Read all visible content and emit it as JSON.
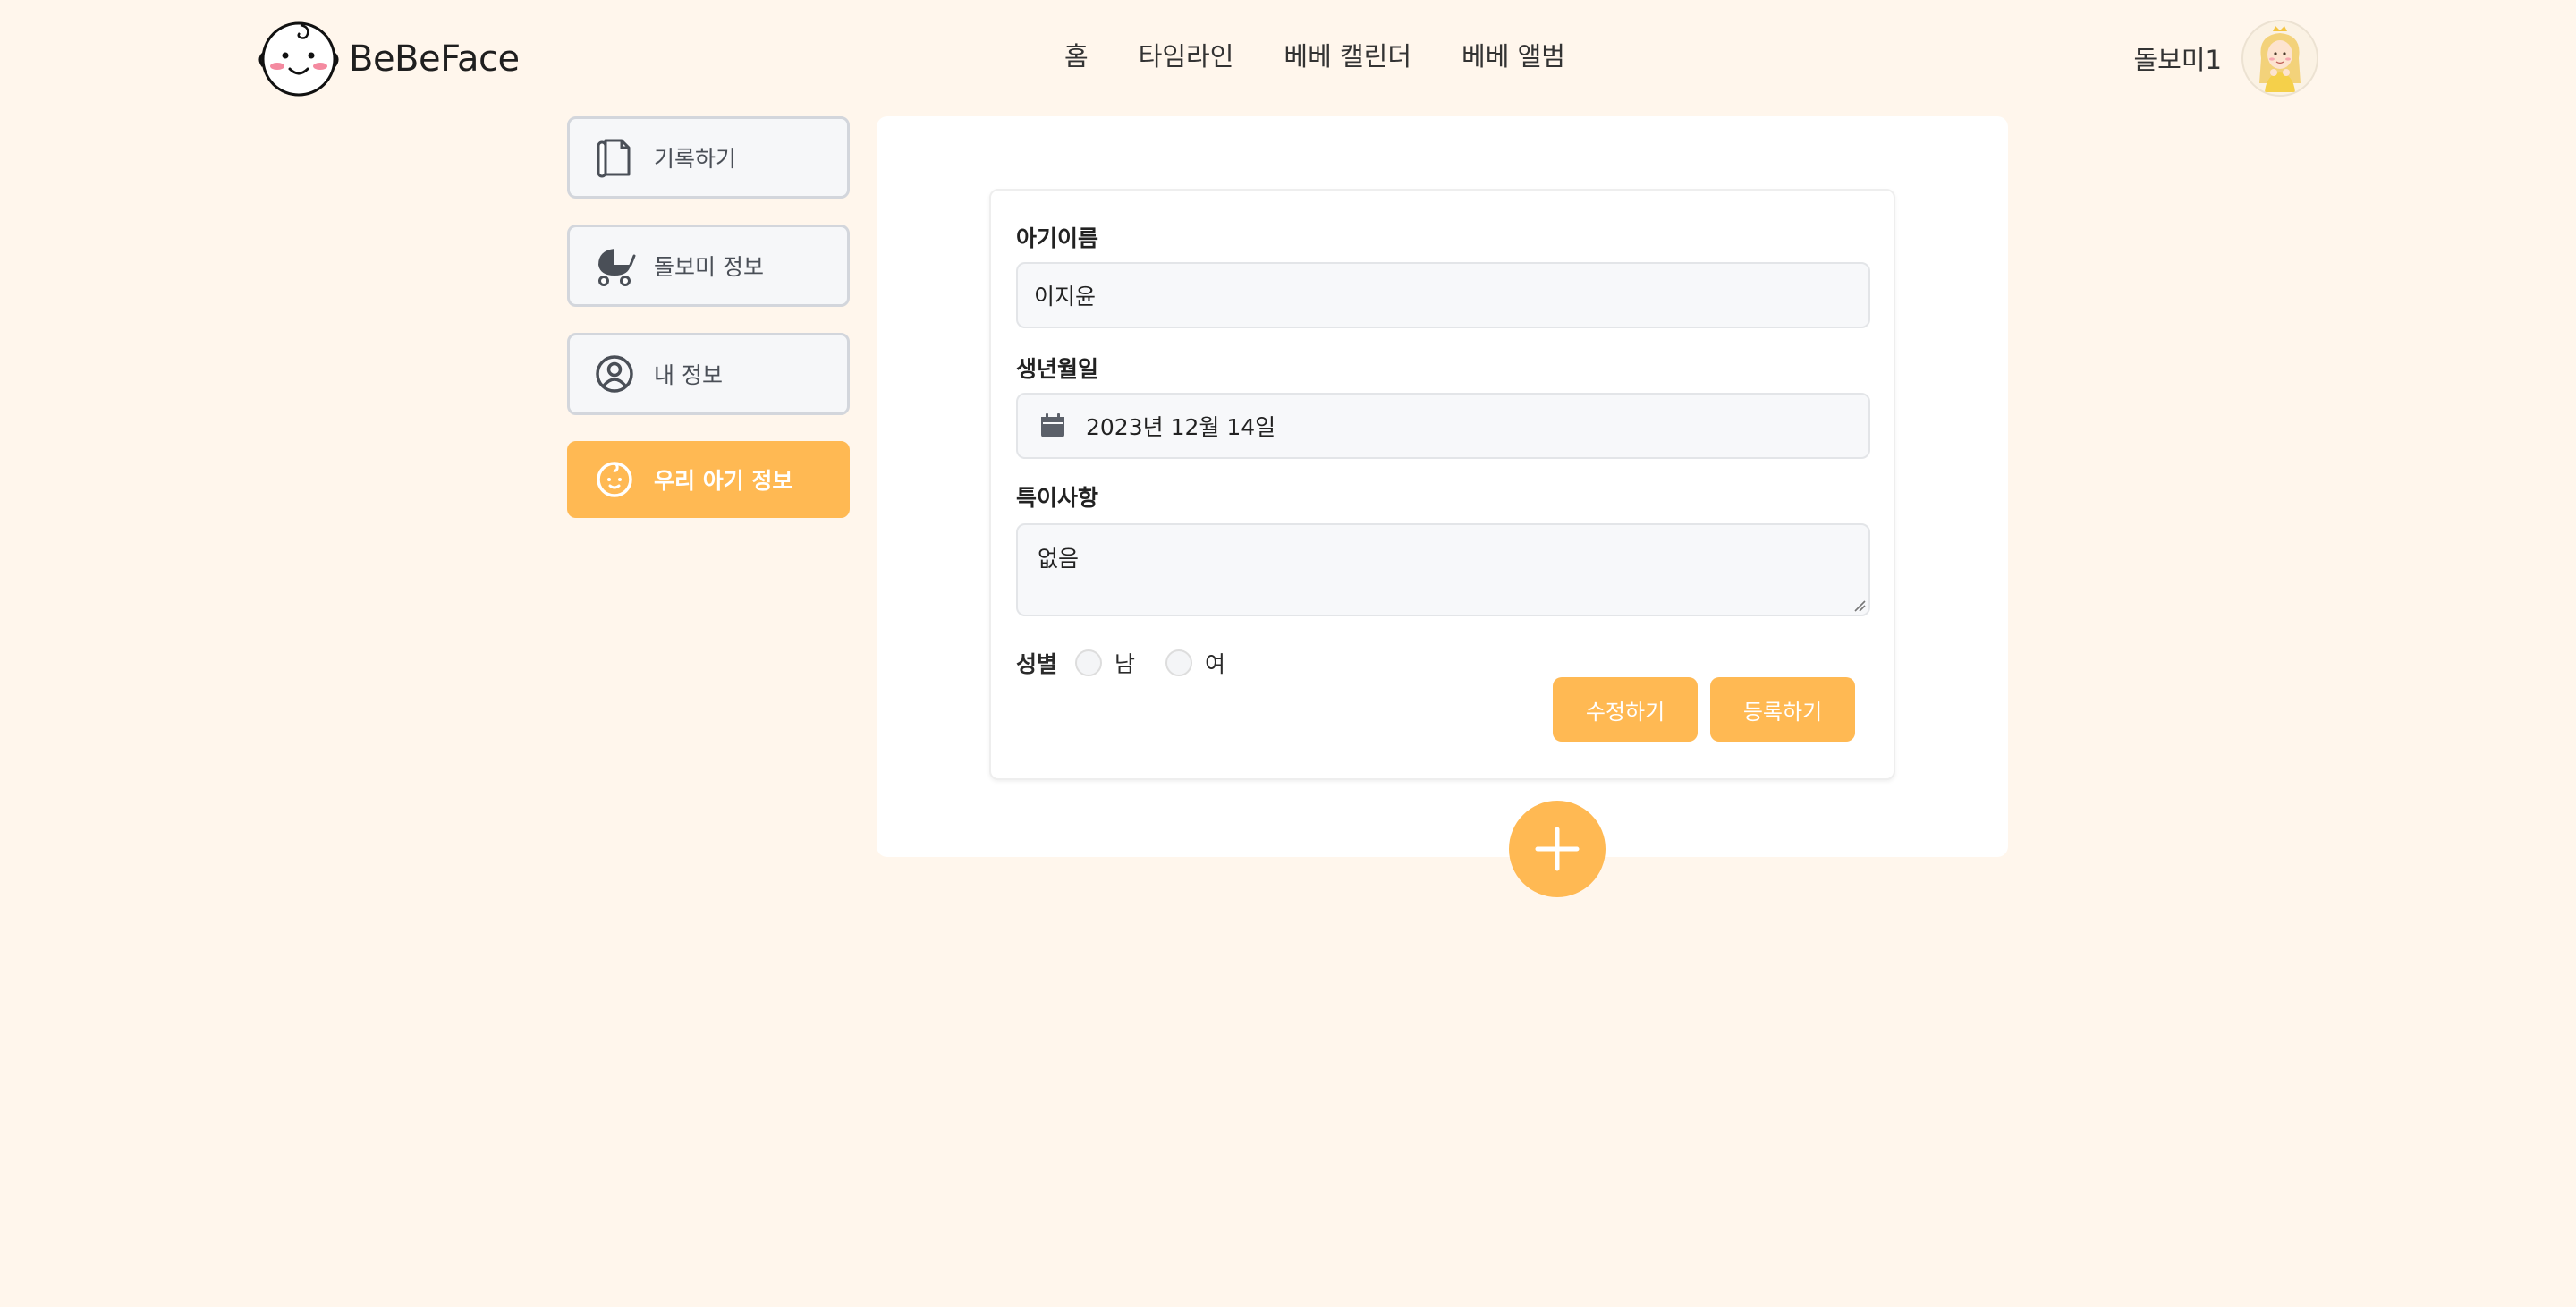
{
  "header": {
    "logo_text": "BeBeFace",
    "nav": [
      {
        "label": "홈"
      },
      {
        "label": "타임라인"
      },
      {
        "label": "베베 캘린더"
      },
      {
        "label": "베베 앨범"
      }
    ],
    "user_name": "돌보미1"
  },
  "sidebar": {
    "items": [
      {
        "label": "기록하기",
        "icon": "document-icon"
      },
      {
        "label": "돌보미 정보",
        "icon": "stroller-icon"
      },
      {
        "label": "내 정보",
        "icon": "user-circle-icon"
      },
      {
        "label": "우리 아기 정보",
        "icon": "baby-face-icon",
        "active": true
      }
    ]
  },
  "form": {
    "name_label": "아기이름",
    "name_value": "이지윤",
    "birth_label": "생년월일",
    "birth_value": "2023년 12월 14일",
    "notes_label": "특이사항",
    "notes_value": "없음",
    "gender_label": "성별",
    "gender_options": [
      "남",
      "여"
    ],
    "edit_button": "수정하기",
    "register_button": "등록하기"
  },
  "colors": {
    "accent": "#ffb953",
    "background": "#fff6ec"
  }
}
